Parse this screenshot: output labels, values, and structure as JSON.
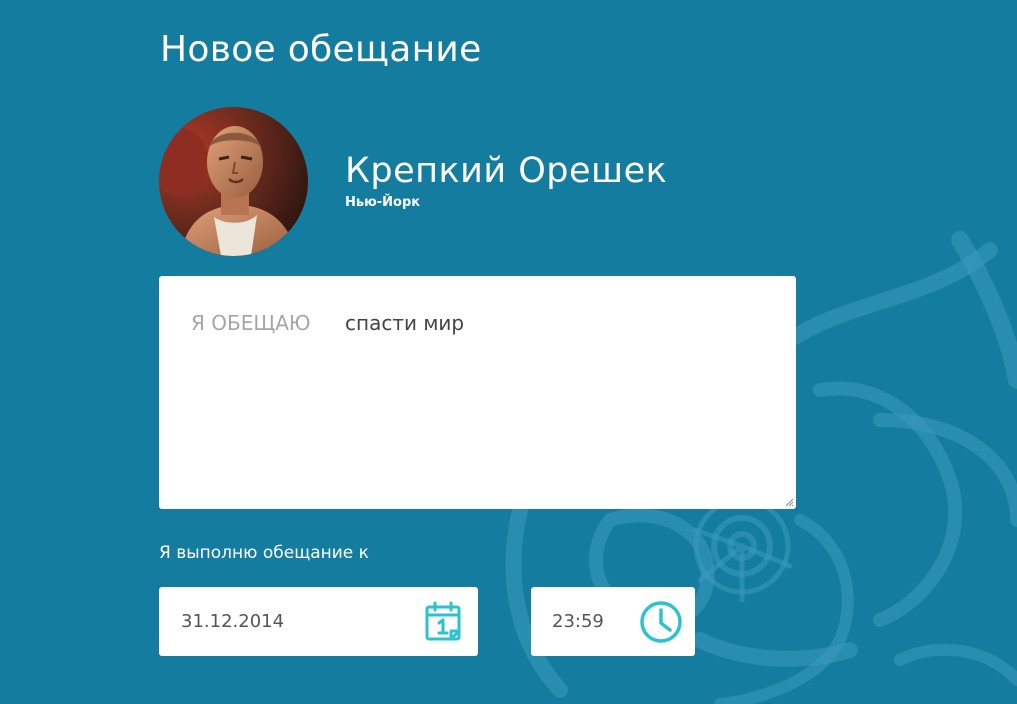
{
  "page": {
    "title": "Новое обещание"
  },
  "profile": {
    "name": "Крепкий Орешек",
    "city": "Нью-Йорк",
    "avatar_icon": "user-avatar-photo"
  },
  "promise": {
    "prefix": "Я ОБЕЩАЮ",
    "text": "спасти мир"
  },
  "deadline": {
    "label": "Я выполню обещание к",
    "date": "31.12.2014",
    "time": "23:59",
    "date_icon": "calendar-icon",
    "time_icon": "clock-icon"
  },
  "colors": {
    "background": "#137c9f",
    "accent": "#2bc3cf",
    "field_background": "#ffffff",
    "placeholder_text": "#a6a6a6"
  }
}
